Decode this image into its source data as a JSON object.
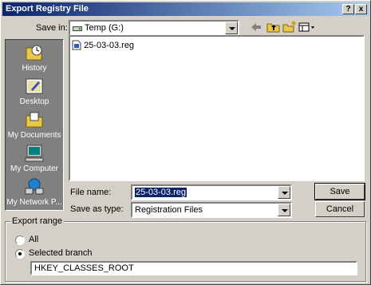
{
  "window": {
    "title": "Export Registry File",
    "help_label": "?",
    "close_label": "x"
  },
  "toolbar": {
    "save_in_label": "Save in:",
    "save_in_value": "Temp (G:)",
    "icons": [
      "back-arrow-icon",
      "up-folder-icon",
      "new-folder-icon",
      "view-menu-icon"
    ]
  },
  "places": [
    {
      "label": "History",
      "icon": "history-icon"
    },
    {
      "label": "Desktop",
      "icon": "desktop-icon"
    },
    {
      "label": "My Documents",
      "icon": "my-documents-icon"
    },
    {
      "label": "My Computer",
      "icon": "my-computer-icon"
    },
    {
      "label": "My Network P...",
      "icon": "network-places-icon"
    }
  ],
  "files": [
    {
      "name": "25-03-03.reg",
      "icon": "reg-file-icon"
    }
  ],
  "form": {
    "file_name_label": "File name:",
    "file_name_value": "25-03-03.reg",
    "save_as_type_label": "Save as type:",
    "save_as_type_value": "Registration Files",
    "save_label": "Save",
    "cancel_label": "Cancel"
  },
  "export_range": {
    "title": "Export range",
    "all_label": "All",
    "selected_label": "Selected branch",
    "selected": "selected_branch",
    "branch_value": "HKEY_CLASSES_ROOT"
  }
}
